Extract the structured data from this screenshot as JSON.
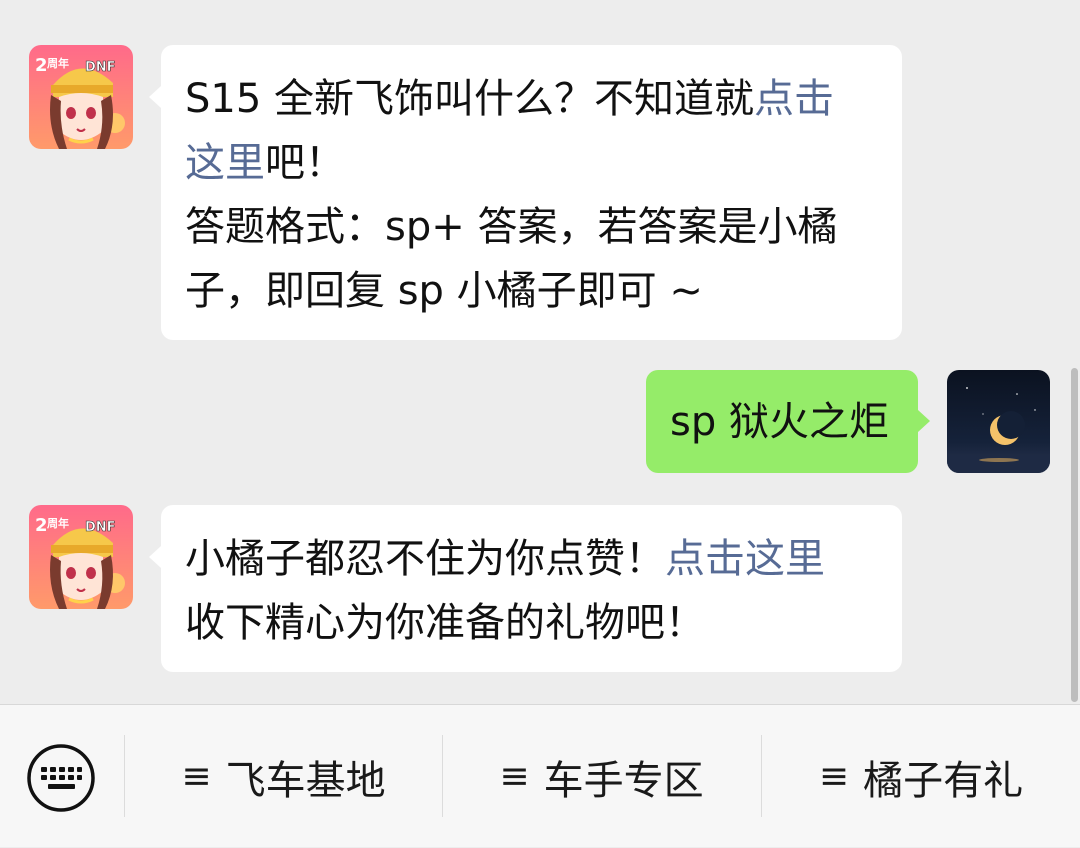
{
  "messages": [
    {
      "direction": "incoming",
      "sender_avatar": "game-app-avatar",
      "lines": [
        {
          "parts": [
            {
              "text": "S15 全新飞饰叫什么？不知道就",
              "link": false
            },
            {
              "text": "点击",
              "link": true
            }
          ]
        },
        {
          "parts": [
            {
              "text": "这里",
              "link": true
            },
            {
              "text": "吧！",
              "link": false
            }
          ]
        },
        {
          "parts": [
            {
              "text": "答题格式：sp+ 答案，若答案是小橘",
              "link": false
            }
          ]
        },
        {
          "parts": [
            {
              "text": "子，即回复 sp 小橘子即可 ~",
              "link": false
            }
          ]
        }
      ]
    },
    {
      "direction": "outgoing",
      "sender_avatar": "user-moon-avatar",
      "text": "sp 狱火之炬"
    },
    {
      "direction": "incoming",
      "sender_avatar": "game-app-avatar",
      "lines": [
        {
          "parts": [
            {
              "text": "小橘子都忍不住为你点赞！",
              "link": false
            },
            {
              "text": "点击这里",
              "link": true
            }
          ]
        },
        {
          "parts": [
            {
              "text": "收下精心为你准备的礼物吧！",
              "link": false
            }
          ]
        }
      ]
    }
  ],
  "avatar_badge": {
    "line1": "2周年",
    "line2": "DNF"
  },
  "menu": {
    "keyboard_icon": "keyboard-icon",
    "items": [
      {
        "glyph": "≡",
        "label": "飞车基地"
      },
      {
        "glyph": "≡",
        "label": "车手专区"
      },
      {
        "glyph": "≡",
        "label": "橘子有礼"
      }
    ]
  },
  "colors": {
    "background": "#ededed",
    "incoming_bubble": "#ffffff",
    "outgoing_bubble": "#95ec69",
    "link": "#576b95"
  }
}
